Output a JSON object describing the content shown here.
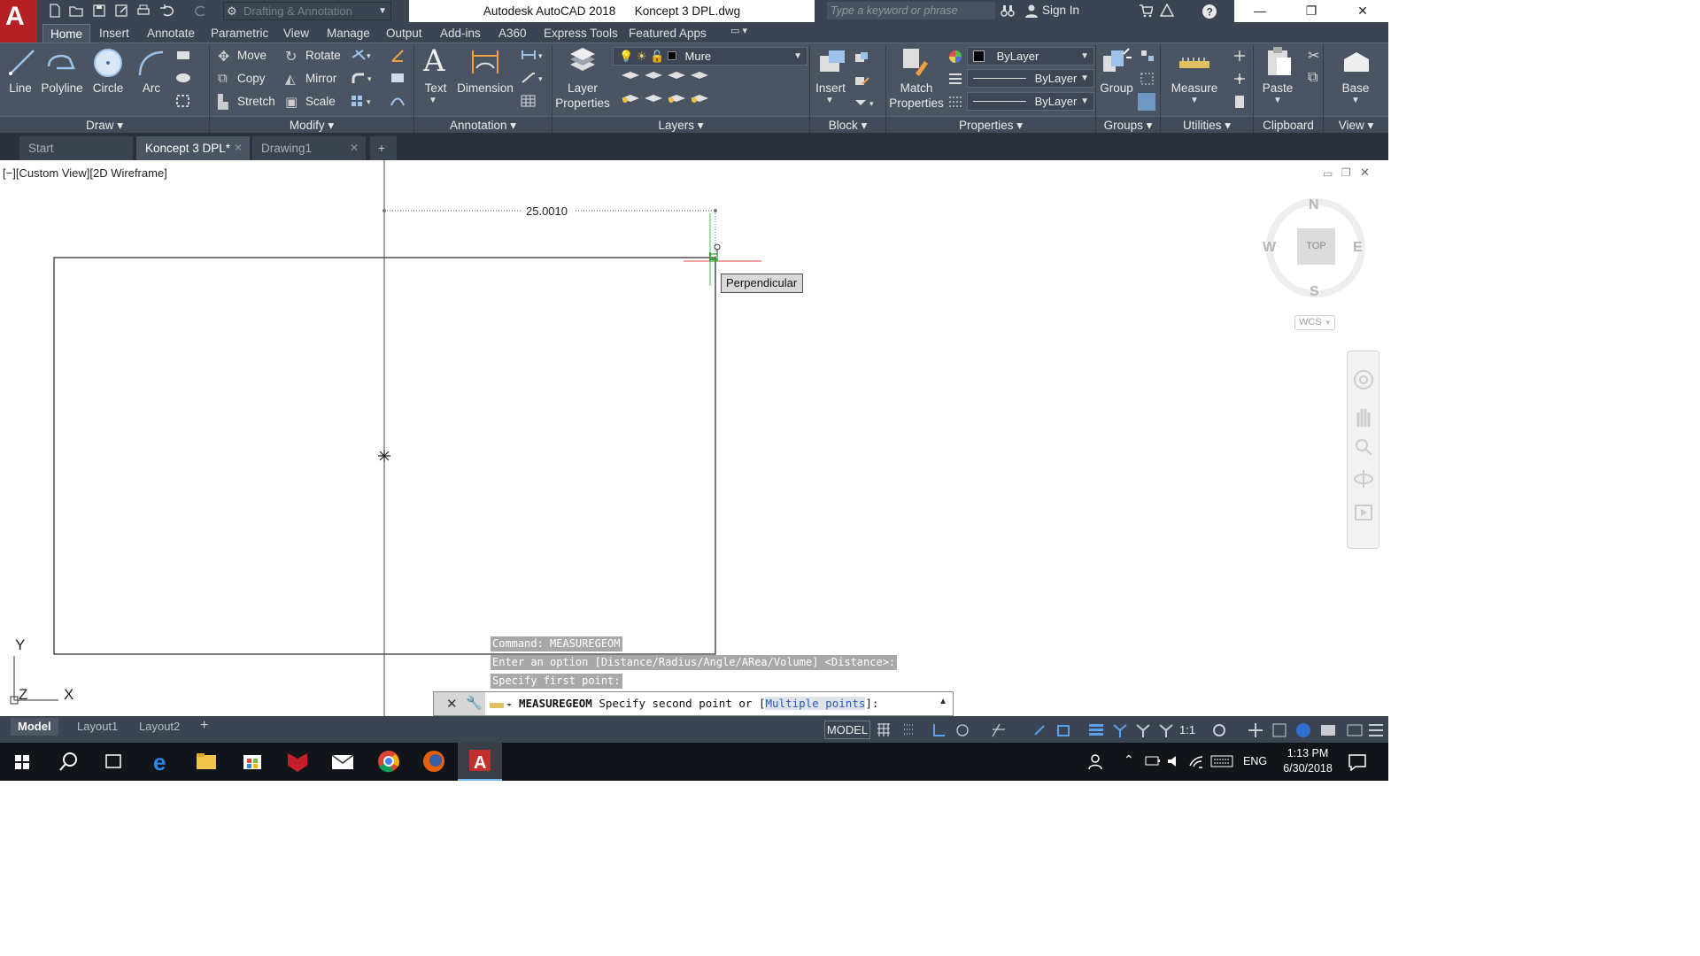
{
  "title_bar": {
    "app_letter": "A",
    "workspace": "Drafting & Annotation",
    "app_name": "Autodesk AutoCAD 2018",
    "file_name": "Koncept 3 DPL.dwg",
    "search_placeholder": "Type a keyword or phrase",
    "sign_in": "Sign In"
  },
  "ribbon_tabs": [
    "Home",
    "Insert",
    "Annotate",
    "Parametric",
    "View",
    "Manage",
    "Output",
    "Add-ins",
    "A360",
    "Express Tools",
    "Featured Apps"
  ],
  "ribbon": {
    "draw": {
      "title": "Draw",
      "line": "Line",
      "polyline": "Polyline",
      "circle": "Circle",
      "arc": "Arc"
    },
    "modify": {
      "title": "Modify",
      "move": "Move",
      "rotate": "Rotate",
      "copy": "Copy",
      "mirror": "Mirror",
      "stretch": "Stretch",
      "scale": "Scale"
    },
    "annotation": {
      "title": "Annotation",
      "text": "Text",
      "dimension": "Dimension"
    },
    "layers": {
      "title": "Layers",
      "layer_properties_1": "Layer",
      "layer_properties_2": "Properties",
      "current_layer": "Mure"
    },
    "block": {
      "title": "Block",
      "insert": "Insert"
    },
    "properties": {
      "title": "Properties",
      "match_1": "Match",
      "match_2": "Properties",
      "color": "ByLayer",
      "linetype": "ByLayer",
      "lineweight": "ByLayer"
    },
    "groups": {
      "title": "Groups",
      "group": "Group"
    },
    "utilities": {
      "title": "Utilities",
      "measure": "Measure"
    },
    "clipboard": {
      "title": "Clipboard",
      "paste": "Paste"
    },
    "view": {
      "title": "View",
      "base": "Base"
    }
  },
  "file_tabs": [
    {
      "label": "Start"
    },
    {
      "label": "Koncept 3 DPL*"
    },
    {
      "label": "Drawing1"
    }
  ],
  "canvas": {
    "view_label": "[−][Custom View][2D Wireframe]",
    "dimension_value": "25.0010",
    "snap_tooltip": "Perpendicular",
    "viewcube": {
      "n": "N",
      "s": "S",
      "e": "E",
      "w": "W",
      "top": "TOP",
      "wcs": "WCS"
    },
    "ucs": {
      "y": "Y",
      "x": "X",
      "z": "Z"
    },
    "command_history": [
      "Command:  MEASUREGEOM",
      "Enter an option [Distance/Radius/Angle/ARea/Volume] <Distance>:",
      "Specify first point:"
    ],
    "command_line": {
      "command": "MEASUREGEOM",
      "prompt_prefix": "Specify second point or [",
      "option_key": "M",
      "option_rest": "ultiple points",
      "prompt_suffix": "]:"
    }
  },
  "status_bar": {
    "layout_tabs": [
      "Model",
      "Layout1",
      "Layout2"
    ],
    "model_button": "MODEL",
    "annotation_scale": "1:1"
  },
  "taskbar": {
    "language": "ENG",
    "time": "1:13 PM",
    "date": "6/30/2018"
  },
  "colors": {
    "accent_red": "#b52025",
    "ribbon_bg": "#4b5463",
    "title_bg": "#3b4453",
    "command_history_bg": "#a8a8a8"
  }
}
